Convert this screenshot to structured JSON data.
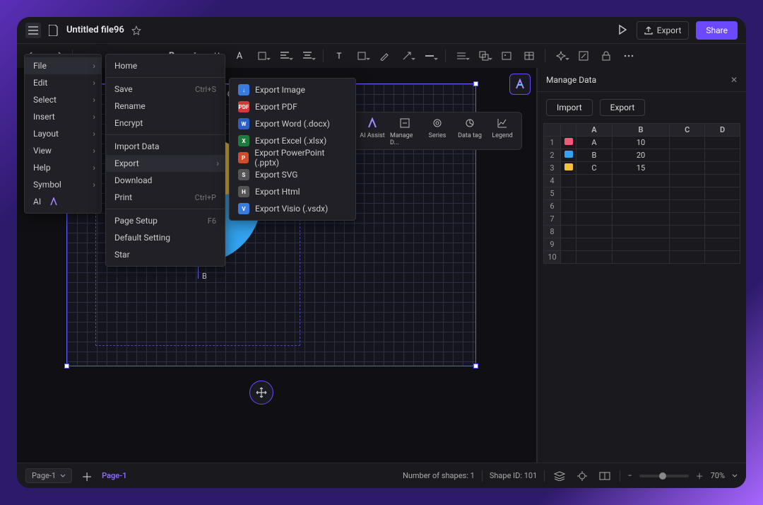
{
  "top": {
    "filename": "Untitled file96",
    "export": "Export",
    "share": "Share"
  },
  "menu1": [
    {
      "label": "File",
      "sub": true,
      "sel": true
    },
    {
      "label": "Edit",
      "sub": true
    },
    {
      "label": "Select",
      "sub": true
    },
    {
      "label": "Insert",
      "sub": true
    },
    {
      "label": "Layout",
      "sub": true
    },
    {
      "label": "View",
      "sub": true
    },
    {
      "label": "Help",
      "sub": true
    },
    {
      "label": "Symbol",
      "sub": true
    },
    {
      "label": "AI",
      "ai": true
    }
  ],
  "menu2": {
    "groups": [
      [
        {
          "label": "Home"
        }
      ],
      [
        {
          "label": "Save",
          "shortcut": "Ctrl+S"
        },
        {
          "label": "Rename"
        },
        {
          "label": "Encrypt"
        }
      ],
      [
        {
          "label": "Import Data"
        },
        {
          "label": "Export",
          "sub": true,
          "sel": true
        },
        {
          "label": "Download"
        },
        {
          "label": "Print",
          "shortcut": "Ctrl+P"
        }
      ],
      [
        {
          "label": "Page Setup",
          "shortcut": "F6"
        },
        {
          "label": "Default Setting"
        },
        {
          "label": "Star"
        }
      ]
    ]
  },
  "menu3": [
    {
      "bg": "#3a7be0",
      "t": "↓",
      "label": "Export Image"
    },
    {
      "bg": "#d13a3a",
      "t": "PDF",
      "label": "Export PDF"
    },
    {
      "bg": "#2b5fc7",
      "t": "W",
      "label": "Export Word (.docx)"
    },
    {
      "bg": "#1f7a3e",
      "t": "X",
      "label": "Export Excel (.xlsx)"
    },
    {
      "bg": "#d14a2a",
      "t": "P",
      "label": "Export PowerPoint (.pptx)"
    },
    {
      "bg": "#555",
      "t": "S",
      "label": "Export SVG"
    },
    {
      "bg": "#555",
      "t": "H",
      "label": "Export Html"
    },
    {
      "bg": "#3a7be0",
      "t": "V",
      "label": "Export Visio (.vsdx)"
    }
  ],
  "chart_toolbar": [
    "AI Assist",
    "Manage D...",
    "Series",
    "Data tag",
    "Legend"
  ],
  "sidepanel": {
    "title": "Manage Data",
    "import": "Import",
    "export": "Export",
    "cols": [
      "A",
      "B",
      "C",
      "D"
    ],
    "rows": [
      {
        "n": "1",
        "color": "#f25a7a",
        "a": "A",
        "b": "10"
      },
      {
        "n": "2",
        "color": "#33a4f1",
        "a": "B",
        "b": "20"
      },
      {
        "n": "3",
        "color": "#f4c23a",
        "a": "C",
        "b": "15"
      },
      {
        "n": "4"
      },
      {
        "n": "5"
      },
      {
        "n": "6"
      },
      {
        "n": "7"
      },
      {
        "n": "8"
      },
      {
        "n": "9"
      },
      {
        "n": "10"
      }
    ]
  },
  "bottom": {
    "page_sel": "Page-1",
    "active_page": "Page-1",
    "shapes": "Number of shapes: 1",
    "shape_id": "Shape ID: 101",
    "zoom": "70%"
  },
  "colors": {
    "A": "#f25a7a",
    "B": "#33a4f1",
    "C": "#f4c23a"
  },
  "chart_data": {
    "type": "pie",
    "title": "",
    "categories": [
      "A",
      "B",
      "C"
    ],
    "values": [
      10,
      20,
      15
    ],
    "series_colors": [
      "#f25a7a",
      "#33a4f1",
      "#f4c23a"
    ],
    "legend_position": "top",
    "label_leader": "B"
  }
}
